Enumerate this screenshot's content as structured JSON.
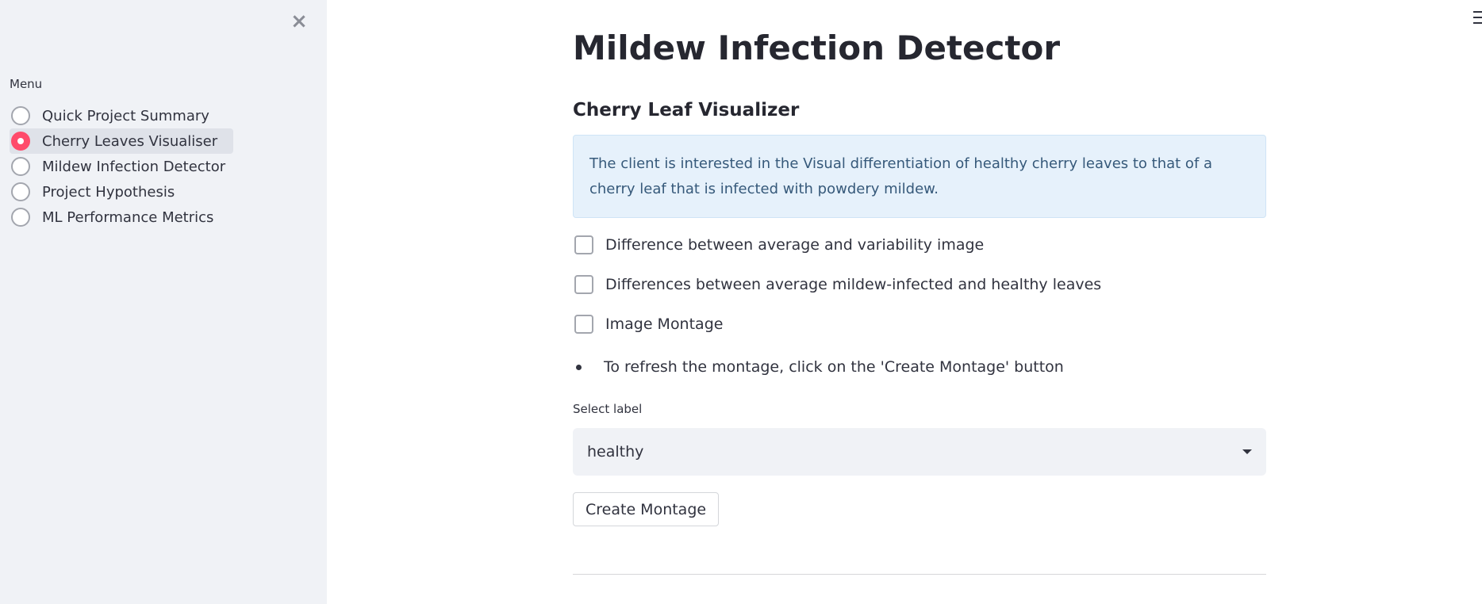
{
  "sidebar": {
    "close_icon": "×",
    "menu_label": "Menu",
    "items": [
      {
        "label": "Quick Project Summary",
        "selected": false
      },
      {
        "label": "Cherry Leaves Visualiser",
        "selected": true
      },
      {
        "label": "Mildew Infection Detector",
        "selected": false
      },
      {
        "label": "Project Hypothesis",
        "selected": false
      },
      {
        "label": "ML Performance Metrics",
        "selected": false
      }
    ],
    "accent_color": "#ff4b6b"
  },
  "main": {
    "title": "Mildew Infection Detector",
    "subheader": "Cherry Leaf Visualizer",
    "info_text": "The client is interested in the Visual differentiation of healthy cherry leaves to that of a cherry leaf that is infected with powdery mildew.",
    "checkboxes": [
      {
        "label": "Difference between average and variability image",
        "checked": false
      },
      {
        "label": "Differences between average mildew-infected and healthy leaves",
        "checked": false
      },
      {
        "label": "Image Montage",
        "checked": false
      }
    ],
    "bullet_text": "To refresh the montage, click on the 'Create Montage' button",
    "select": {
      "label": "Select label",
      "value": "healthy"
    },
    "button_label": "Create Montage"
  }
}
